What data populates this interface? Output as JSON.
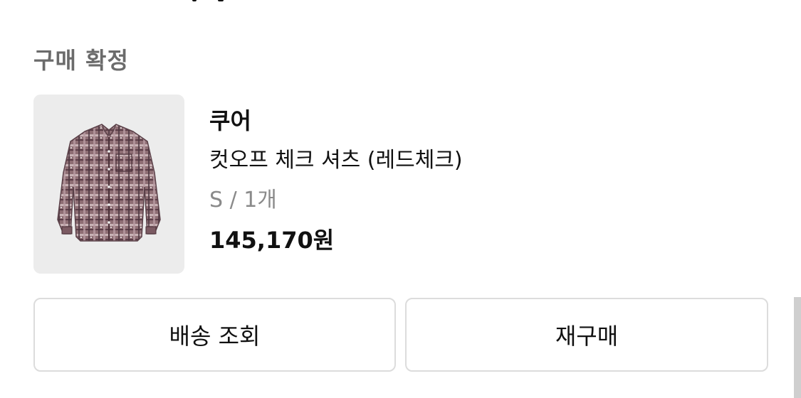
{
  "order": {
    "status_label": "구매 확정",
    "item": {
      "brand": "쿠어",
      "name": "컷오프 체크 셔츠 (레드체크)",
      "option": "S / 1개",
      "price": "145,170원",
      "thumbnail_icon": "plaid-shirt-image"
    },
    "actions": {
      "track_shipping_label": "배송 조회",
      "reorder_label": "재구매"
    }
  },
  "colors": {
    "status_text": "#6b6b6b",
    "option_text": "#8a8a8a",
    "button_border": "#dcdcdc",
    "thumb_bg": "#ececec"
  }
}
